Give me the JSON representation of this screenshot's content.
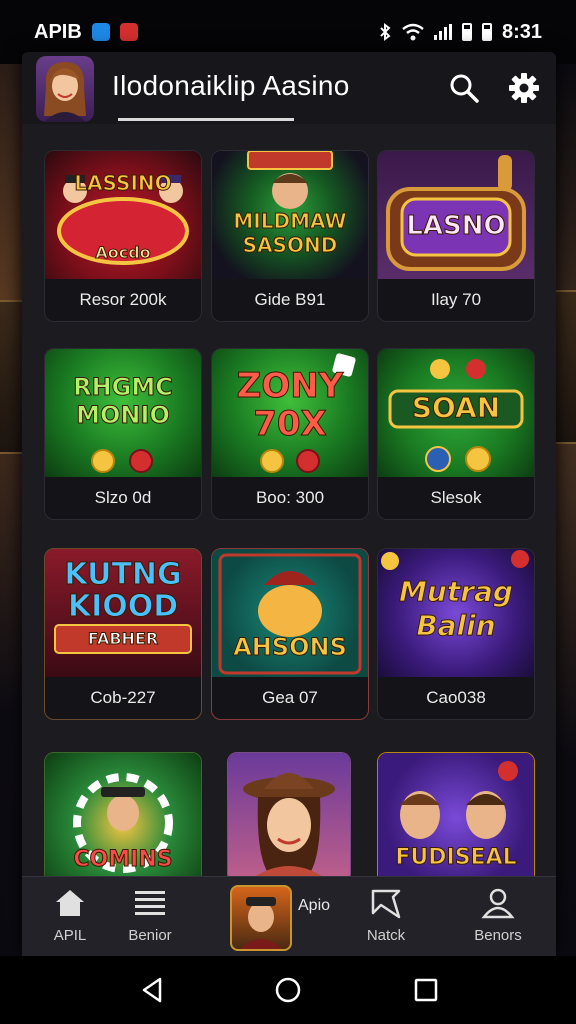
{
  "status_bar": {
    "left_text": "APIB",
    "time": "8:31"
  },
  "header": {
    "title": "Ilodonaiklip Aasino"
  },
  "tiles": [
    {
      "brand": "LASSINO",
      "sub": "Aocdo",
      "caption": "Resor 200k",
      "theme": "red"
    },
    {
      "brand": "MILDMAW SASOND",
      "sub": "",
      "caption": "Gide B91",
      "theme": "green-dark"
    },
    {
      "brand": "LASNO",
      "sub": "",
      "caption": "Ilay 70",
      "theme": "purple"
    },
    {
      "brand": "RHGMC MONIO",
      "sub": "",
      "caption": "Slzo 0d",
      "theme": "green"
    },
    {
      "brand": "ZONY 70X",
      "sub": "",
      "caption": "Boo: 300",
      "theme": "green"
    },
    {
      "brand": "SOAN",
      "sub": "",
      "caption": "Slesok",
      "theme": "green"
    },
    {
      "brand": "KUTNG KIOOD",
      "sub": "FABHER",
      "caption": "Cob-227",
      "theme": "red-gold"
    },
    {
      "brand": "AHSONS",
      "sub": "",
      "caption": "Gea 07",
      "theme": "teal"
    },
    {
      "brand": "Mutrag Balin",
      "sub": "",
      "caption": "Cao038",
      "theme": "violet"
    },
    {
      "brand": "COMINS",
      "sub": "",
      "caption": "",
      "theme": "green-ring"
    },
    {
      "brand": "",
      "sub": "",
      "caption": "",
      "theme": "portrait"
    },
    {
      "brand": "FUDISEAL",
      "sub": "",
      "caption": "",
      "theme": "duo"
    }
  ],
  "bottom_nav": {
    "home_label": "APIL",
    "menu_label": "Benior",
    "center_label": "Apio",
    "tools_label": "Natck",
    "profile_label": "Benors"
  },
  "colors": {
    "accent_gold": "#f5c542",
    "panel": "#1c1b20",
    "nav": "#232228"
  }
}
